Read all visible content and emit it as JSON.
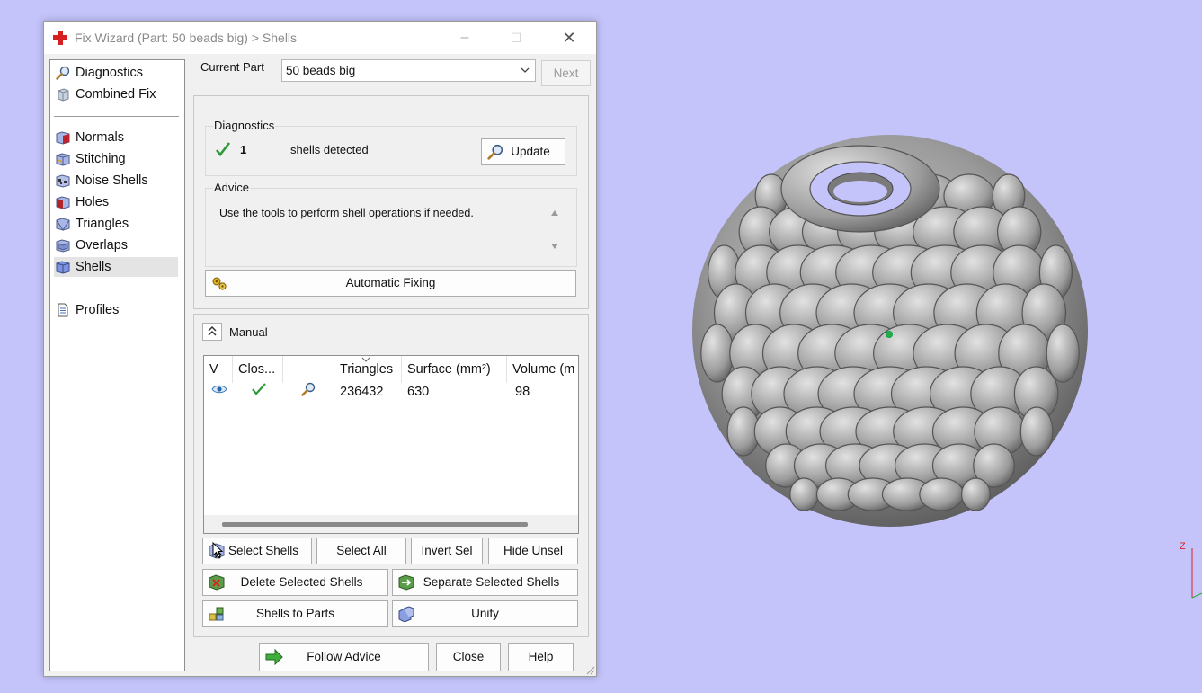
{
  "window": {
    "title": "Fix Wizard (Part: 50 beads big) > Shells",
    "minimize": "–",
    "maximize": "☐",
    "close": "✕"
  },
  "nav": {
    "group1": [
      {
        "label": "Diagnostics",
        "icon": "magnifier-icon"
      },
      {
        "label": "Combined Fix",
        "icon": "cube-icon"
      }
    ],
    "group2": [
      {
        "label": "Normals",
        "icon": "normals-cube-icon"
      },
      {
        "label": "Stitching",
        "icon": "stitching-cube-icon"
      },
      {
        "label": "Noise Shells",
        "icon": "noise-shells-icon"
      },
      {
        "label": "Holes",
        "icon": "holes-cube-icon"
      },
      {
        "label": "Triangles",
        "icon": "triangles-cube-icon"
      },
      {
        "label": "Overlaps",
        "icon": "overlaps-cube-icon"
      },
      {
        "label": "Shells",
        "icon": "shells-cube-icon",
        "selected": true
      }
    ],
    "group3": [
      {
        "label": "Profiles",
        "icon": "document-icon"
      }
    ]
  },
  "top": {
    "current_part_label": "Current Part",
    "current_part_value": "50 beads big",
    "next_button": "Next"
  },
  "diagnostics": {
    "title": "Diagnostics",
    "count": "1",
    "text": "shells detected",
    "update_button": "Update"
  },
  "advice": {
    "title": "Advice",
    "text": "Use the tools to perform shell operations if needed."
  },
  "automatic_fixing_button": "Automatic Fixing",
  "manual": {
    "title": "Manual",
    "columns": [
      "V",
      "Clos...",
      "",
      "Triangles",
      "Surface (mm²)",
      "Volume (m"
    ],
    "rows": [
      {
        "triangles": "236432",
        "surface": "630",
        "volume": "98"
      }
    ]
  },
  "actions": {
    "select_shells": "Select Shells",
    "select_all": "Select All",
    "invert_sel": "Invert Sel",
    "hide_unsel": "Hide Unsel",
    "delete_selected": "Delete Selected Shells",
    "separate_selected": "Separate Selected Shells",
    "shells_to_parts": "Shells to Parts",
    "unify": "Unify"
  },
  "footer": {
    "follow_advice": "Follow Advice",
    "close": "Close",
    "help": "Help"
  },
  "viewport": {
    "axis_label": "Z"
  },
  "colors": {
    "viewport_bg": "#c4c4fb",
    "check_green": "#2e9a3a",
    "title_gray": "#8a8a8a"
  }
}
